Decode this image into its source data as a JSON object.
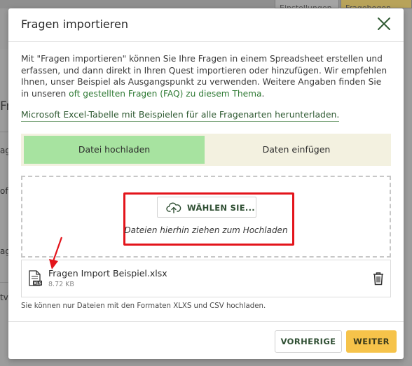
{
  "background": {
    "tabs": [
      "Einstellungen",
      "Fragebogen"
    ],
    "side_fragments": [
      "Fr",
      "ag",
      "oft",
      "ag",
      "tv"
    ]
  },
  "modal": {
    "title": "Fragen importieren",
    "intro_text": "Mit \"Fragen importieren\" können Sie Ihre Fragen in einem Spreadsheet erstellen und erfassen, und dann direkt in Ihren Quest importieren oder hinzufügen. Wir empfehlen Ihnen, unser Beispiel als Ausgangspunkt zu verwenden. Weitere Angaben finden Sie in unseren ",
    "intro_link": "oft gestellten Fragen (FAQ) zu diesem Thema",
    "intro_end": ".",
    "excel_link": "Microsoft Excel-Tabelle mit Beispielen für alle Fragenarten herunterladen.",
    "tabs": {
      "upload": "Datei hochladen",
      "paste": "Daten einfügen"
    },
    "dropzone": {
      "button_label": "WÄHLEN SIE...",
      "hint": "Dateien hierhin ziehen zum Hochladen"
    },
    "file": {
      "name": "Fragen Import Beispiel.xlsx",
      "size": "8.72 KB",
      "type_badge": "XLS"
    },
    "formats_note": "Sie können nur Dateien mit den Formaten XLXS und CSV hochladen.",
    "buttons": {
      "previous": "VORHERIGE",
      "next": "WEITER"
    }
  },
  "colors": {
    "active_tab": "#a7e3a0",
    "tab_bar": "#f3f1e0",
    "primary_button": "#f6c34a",
    "annotation_red": "#e3141b",
    "link_green": "#2f7a34"
  },
  "icons": [
    "close-icon",
    "upload-cloud-icon",
    "xls-file-icon",
    "trash-icon",
    "annotation-arrow"
  ]
}
